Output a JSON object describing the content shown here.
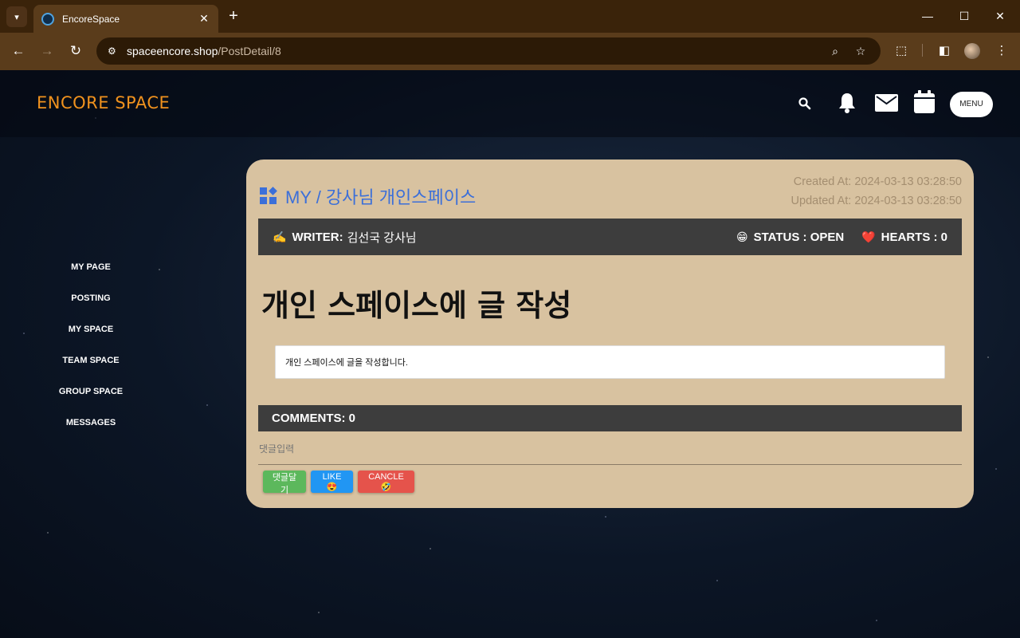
{
  "browser": {
    "tab_title": "EncoreSpace",
    "url_domain": "spaceencore.shop",
    "url_path": "/PostDetail/8"
  },
  "site": {
    "logo": "ENCORE SPACE",
    "menu_label": "MENU"
  },
  "sidebar": {
    "items": [
      {
        "label": "MY PAGE"
      },
      {
        "label": "POSTING"
      },
      {
        "label": "MY SPACE"
      },
      {
        "label": "TEAM SPACE"
      },
      {
        "label": "GROUP SPACE"
      },
      {
        "label": "MESSAGES"
      }
    ]
  },
  "post": {
    "breadcrumb": "MY / 강사님 개인스페이스",
    "created_at": "Created At: 2024-03-13 03:28:50",
    "updated_at": "Updated At: 2024-03-13 03:28:50",
    "writer_label": "WRITER:",
    "writer_name": "김선국 강사님",
    "writer_emoji": "✍️",
    "status": "STATUS : OPEN",
    "status_emoji": "😁",
    "hearts": "HEARTS : 0",
    "hearts_emoji": "❤️",
    "title": "개인 스페이스에 글 작성",
    "body": "개인 스페이스에 글을 작성합니다."
  },
  "comments": {
    "header": "COMMENTS: 0",
    "input_placeholder": "댓글입력",
    "submit_label": "댓글달기",
    "like_label": "LIKE 😍",
    "cancel_label": "CANCLE 🤣"
  },
  "colors": {
    "logo": "#f0921e",
    "card_bg": "#d8c2a0",
    "breadcrumb": "#3b6fd9",
    "bar_bg": "#3d3d3d",
    "btn_green": "#5cb85c",
    "btn_blue": "#2196f3",
    "btn_red": "#e5534b"
  }
}
